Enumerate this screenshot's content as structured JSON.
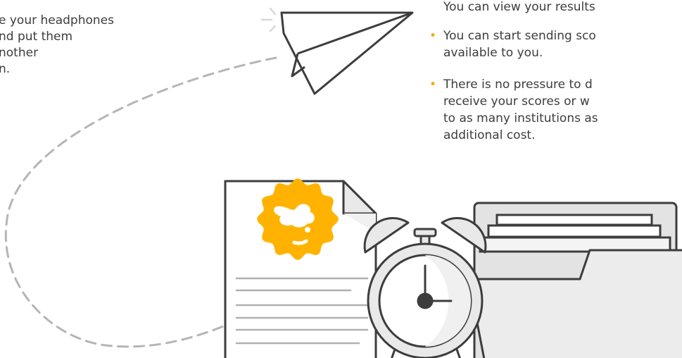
{
  "left_text": {
    "lines": [
      "e your headphones",
      "nd put them",
      "nother",
      "n."
    ]
  },
  "right_list": {
    "continuation": "You can view your results",
    "items": [
      {
        "lines": [
          "You can start sending sco",
          "available to you."
        ]
      },
      {
        "lines": [
          "There is no pressure to d",
          "receive your scores or w",
          "to as many institutions as",
          "additional cost."
        ]
      }
    ],
    "bullet_color": "#f5a800"
  },
  "illustration": {
    "icons": [
      "paper-plane-icon",
      "certificate-document-icon",
      "badge-seal-icon",
      "alarm-clock-icon",
      "file-folder-icon"
    ],
    "colors": {
      "outline": "#3d3d3d",
      "fill": "#e9e9e9",
      "badge": "#ffb300",
      "dash": "#b5b5b5"
    }
  }
}
